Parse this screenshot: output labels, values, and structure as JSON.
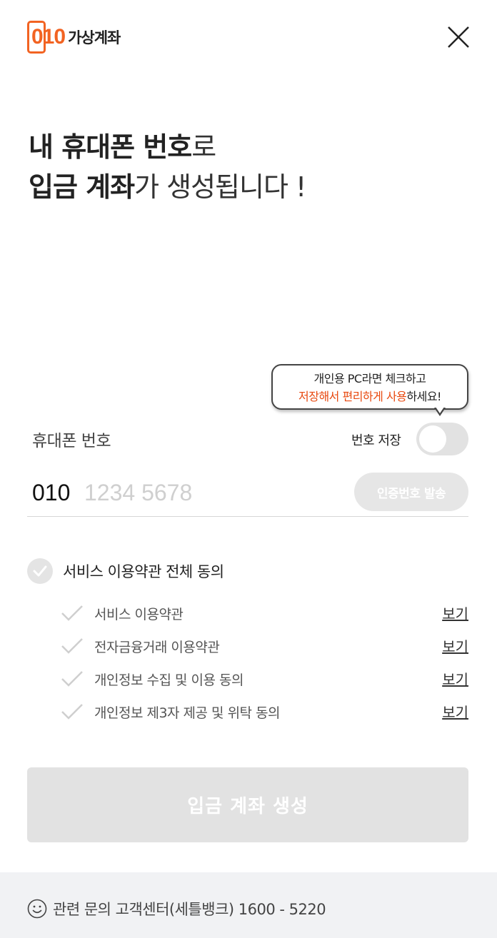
{
  "brand": {
    "logo_number": "010",
    "logo_text": "가상계좌",
    "accent_color": "#f26322"
  },
  "headline": {
    "line1_bold": "내 휴대폰 번호",
    "line1_rest": "로",
    "line2_bold": "입금 계좌",
    "line2_rest": "가 생성됩니다 !"
  },
  "tooltip": {
    "line1": "개인용 PC라면 체크하고",
    "line2_accent": "저장해서 편리하게 사용",
    "line2_rest": "하세요!"
  },
  "phone": {
    "label": "휴대폰 번호",
    "save_label": "번호 저장",
    "save_enabled": false,
    "prefix": "010",
    "value": "",
    "placeholder": "1234 5678",
    "send_button": "인증번호 발송"
  },
  "agreements": {
    "all_label": "서비스 이용약관 전체 동의",
    "view_label": "보기",
    "items": [
      {
        "label": "서비스 이용약관"
      },
      {
        "label": "전자금융거래 이용약관"
      },
      {
        "label": "개인정보 수집 및 이용 동의"
      },
      {
        "label": "개인정보 제3자 제공 및 위탁 동의"
      }
    ]
  },
  "submit_button": "입금 계좌 생성",
  "footer": {
    "text": "관련 문의 고객센터(세틀뱅크) 1600 - 5220",
    "icon": "smile-icon"
  },
  "icons": {
    "close": "close-icon",
    "check": "check-icon"
  },
  "colors": {
    "accent": "#e8490f",
    "disabled": "#e2e2e2",
    "footer_bg": "#f1f2f4"
  }
}
